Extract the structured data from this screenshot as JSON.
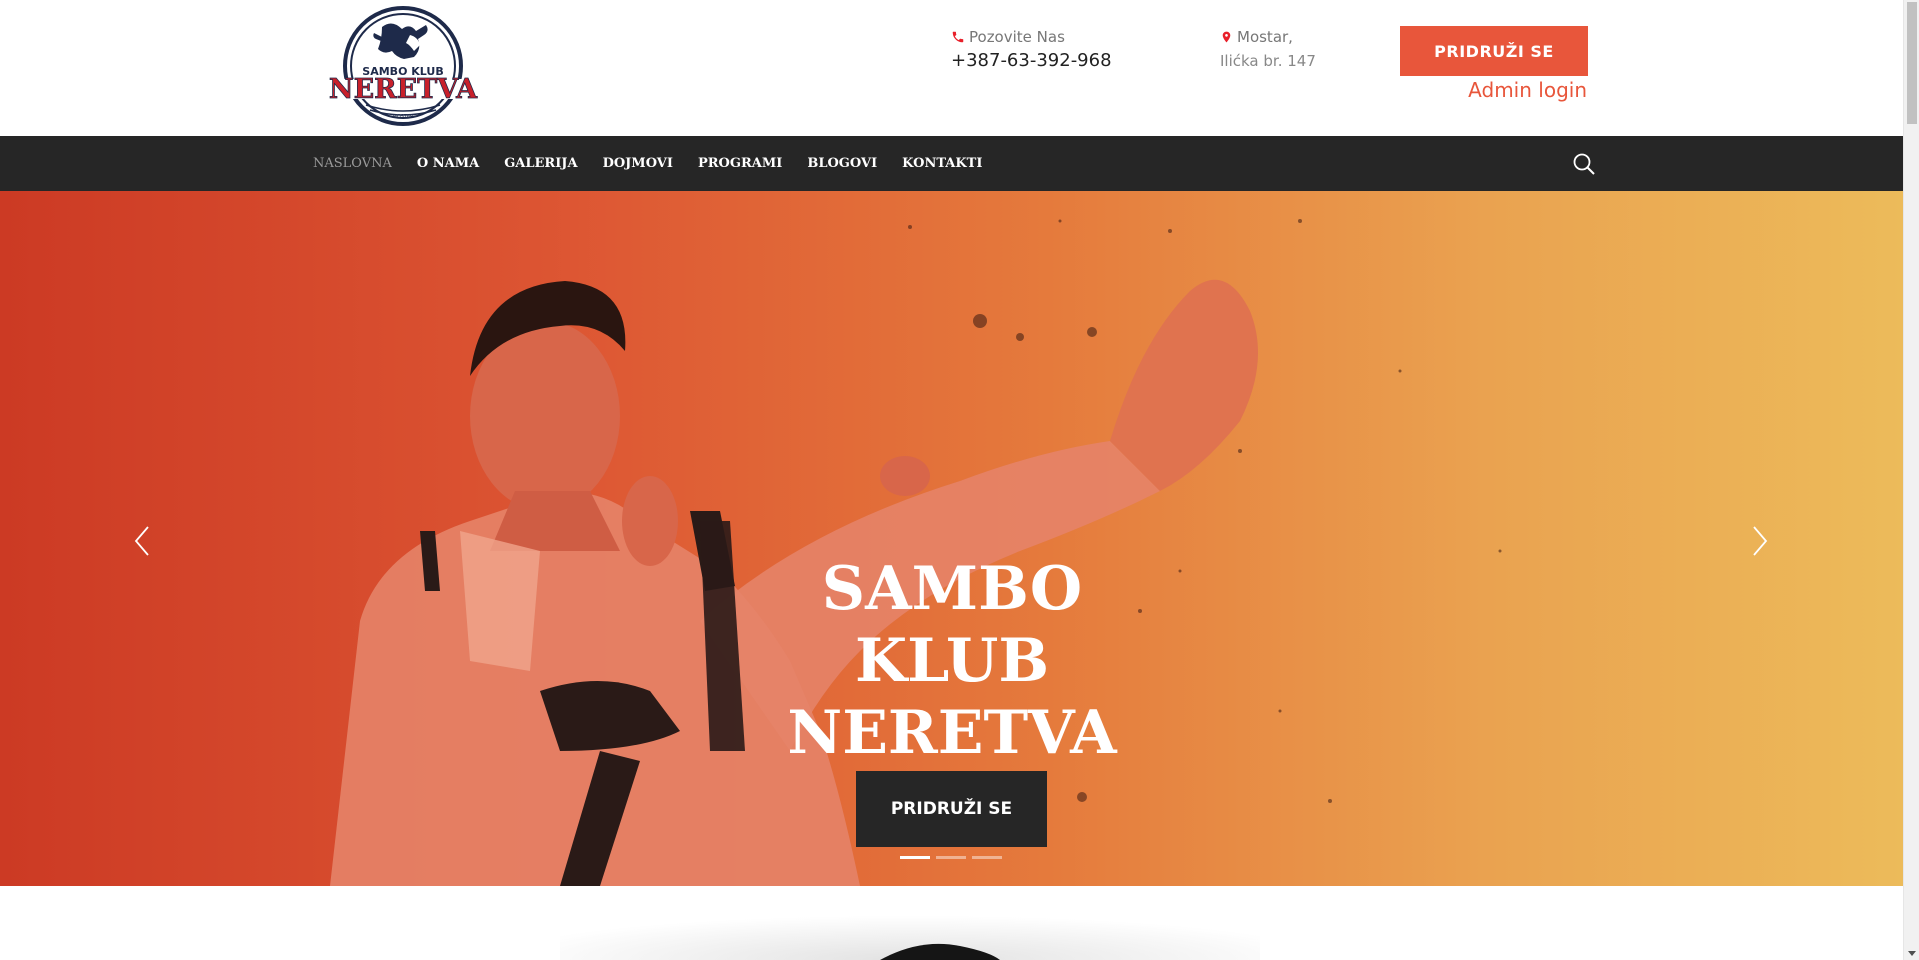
{
  "header": {
    "logo": {
      "top_text": "SAMBO KLUB",
      "main_text": "NERETVA",
      "bottom_text": "MOSTAR"
    },
    "phone": {
      "label": "Pozovite Nas",
      "value": "+387-63-392-968",
      "icon": "phone-icon"
    },
    "address": {
      "line1": "Mostar,",
      "line2": "Ilićka br. 147",
      "icon": "map-pin-icon"
    },
    "join_button": "PRIDRUŽI SE",
    "admin_login": "Admin login"
  },
  "nav": {
    "items": [
      {
        "label": "NASLOVNA",
        "active": true
      },
      {
        "label": "O NAMA",
        "active": false
      },
      {
        "label": "GALERIJA",
        "active": false
      },
      {
        "label": "DOJMOVI",
        "active": false
      },
      {
        "label": "PROGRAMI",
        "active": false
      },
      {
        "label": "BLOGOVI",
        "active": false
      },
      {
        "label": "KONTAKTI",
        "active": false
      }
    ],
    "search_icon": "search-icon"
  },
  "hero": {
    "title_lines": [
      "SAMBO",
      "KLUB",
      "NERETVA"
    ],
    "button": "PRIDRUŽI SE",
    "prev_icon": "chevron-left-icon",
    "next_icon": "chevron-right-icon",
    "slides": 3,
    "active_slide": 1
  },
  "colors": {
    "accent": "#e8563b",
    "navbar": "#262626",
    "hero_gradient_start": "#cc3a24",
    "hero_gradient_end": "#ecbb5a"
  }
}
